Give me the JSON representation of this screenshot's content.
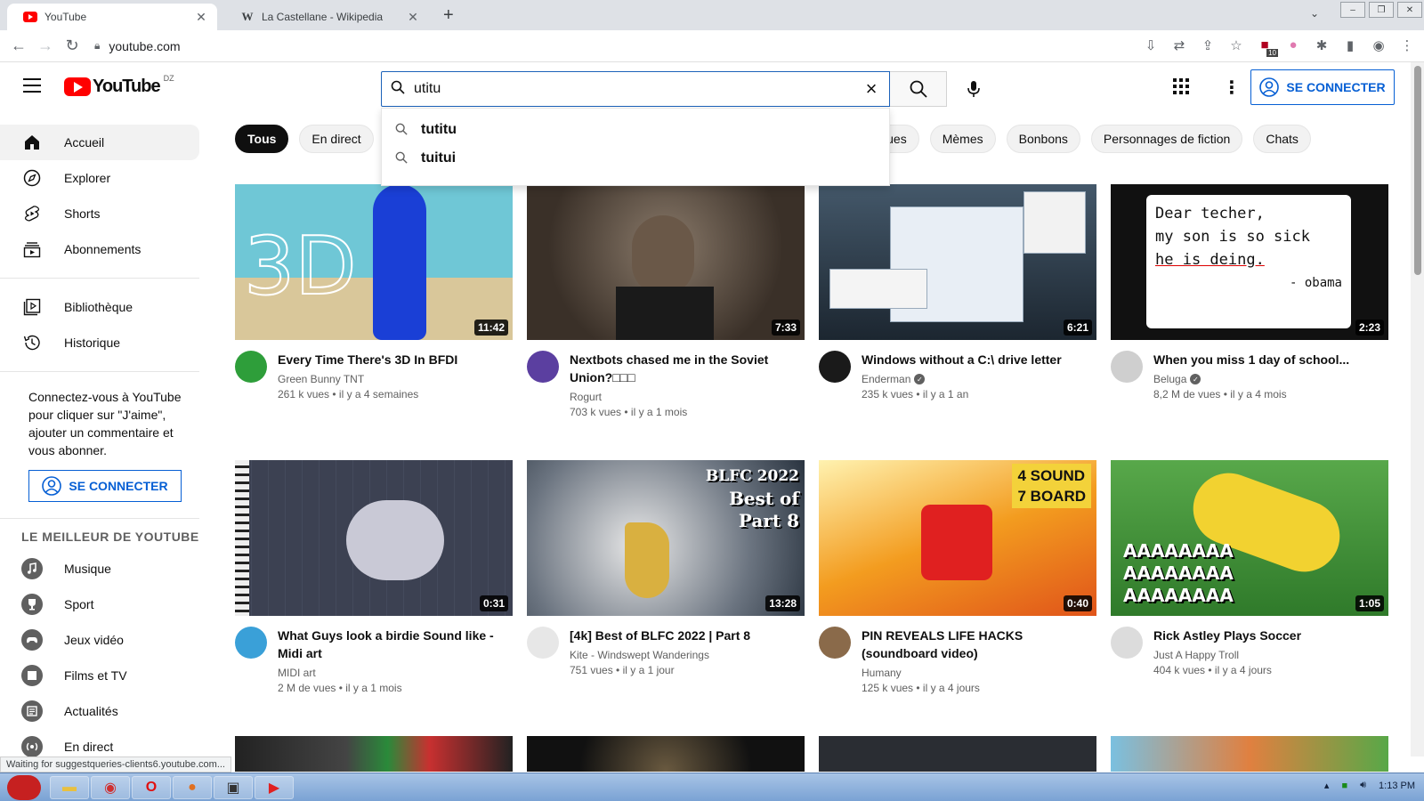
{
  "browser": {
    "tabs": [
      {
        "title": "YouTube",
        "active": true
      },
      {
        "title": "La Castellane - Wikipedia",
        "active": false
      }
    ],
    "url": "youtube.com",
    "status_text": "Waiting for suggestqueries-clients6.youtube.com...",
    "ext_badge": "10"
  },
  "header": {
    "logo_text": "YouTube",
    "region": "DZ",
    "search_value": "utitu",
    "signin_label": "SE CONNECTER"
  },
  "suggestions": [
    "tutitu",
    "tuitui"
  ],
  "sidebar": {
    "main": [
      {
        "label": "Accueil",
        "icon": "home-icon",
        "active": true
      },
      {
        "label": "Explorer",
        "icon": "compass-icon"
      },
      {
        "label": "Shorts",
        "icon": "shorts-icon"
      },
      {
        "label": "Abonnements",
        "icon": "subscriptions-icon"
      }
    ],
    "library": [
      {
        "label": "Bibliothèque",
        "icon": "library-icon"
      },
      {
        "label": "Historique",
        "icon": "history-icon"
      }
    ],
    "promo_text": "Connectez-vous à YouTube pour cliquer sur \"J'aime\", ajouter un commentaire et vous abonner.",
    "signin_label": "SE CONNECTER",
    "best_title": "LE MEILLEUR DE YOUTUBE",
    "best": [
      {
        "label": "Musique",
        "icon": "music-icon"
      },
      {
        "label": "Sport",
        "icon": "trophy-icon"
      },
      {
        "label": "Jeux vidéo",
        "icon": "gaming-icon"
      },
      {
        "label": "Films et TV",
        "icon": "film-icon"
      },
      {
        "label": "Actualités",
        "icon": "news-icon"
      },
      {
        "label": "En direct",
        "icon": "live-icon"
      }
    ]
  },
  "chips": [
    "Tous",
    "En direct",
    "atériels informatiques",
    "Mèmes",
    "Bonbons",
    "Personnages de fiction",
    "Chats"
  ],
  "videos": [
    {
      "title": "Every Time There's 3D In BFDI",
      "channel": "Green Bunny TNT",
      "verified": false,
      "stats": "261 k vues • il y a 4 semaines",
      "duration": "11:42",
      "thumb_color": "#6fc7d6",
      "avatar_color": "#2e9e3a"
    },
    {
      "title": "Nextbots chased me in the Soviet Union?□□□",
      "channel": "Rogurt",
      "verified": false,
      "stats": "703 k vues • il y a 1 mois",
      "duration": "7:33",
      "thumb_color": "#6b5a4a",
      "avatar_color": "#5b3fa0"
    },
    {
      "title": "Windows without a C:\\ drive letter",
      "channel": "Enderman",
      "verified": true,
      "stats": "235 k vues • il y a 1 an",
      "duration": "6:21",
      "thumb_color": "#2b3a4a",
      "avatar_color": "#1a1a1a"
    },
    {
      "title": "When you miss 1 day of school...",
      "channel": "Beluga",
      "verified": true,
      "stats": "8,2 M de vues • il y a 4 mois",
      "duration": "2:23",
      "thumb_color": "#111111",
      "avatar_color": "#cfcfcf"
    },
    {
      "title": "What Guys look a birdie Sound like - Midi art",
      "channel": "MIDI art",
      "verified": false,
      "stats": "2 M de vues • il y a 1 mois",
      "duration": "0:31",
      "thumb_color": "#3c4152",
      "avatar_color": "#3aa0d8"
    },
    {
      "title": "[4k] Best of BLFC 2022 | Part 8",
      "channel": "Kite - Windswept Wanderings",
      "verified": false,
      "stats": "751 vues • il y a 1 jour",
      "duration": "13:28",
      "thumb_color": "#3b4a5c",
      "avatar_color": "#e7e7e7"
    },
    {
      "title": "PIN REVEALS LIFE HACKS (soundboard video)",
      "channel": "Humany",
      "verified": false,
      "stats": "125 k vues • il y a 4 jours",
      "duration": "0:40",
      "thumb_color": "#f0a020",
      "avatar_color": "#8a6a4a"
    },
    {
      "title": "Rick Astley Plays Soccer",
      "channel": "Just A Happy Troll",
      "verified": false,
      "stats": "404 k vues • il y a 4 jours",
      "duration": "1:05",
      "thumb_color": "#3f8a34",
      "avatar_color": "#dcdcdc"
    }
  ],
  "thumb_texts": {
    "v1": "3D",
    "v4": [
      "Dear techer,",
      "my son is so sick",
      "he is deing.",
      "- obama"
    ],
    "v6": [
      "BLFC 2022",
      "Best of",
      "Part 8"
    ],
    "v7": [
      "4 SOUND",
      "7 BOARD"
    ],
    "v8": [
      "AAAAAAAA",
      "AAAAAAAA",
      "AAAAAAAA"
    ]
  },
  "taskbar": {
    "time": "1:13 PM"
  },
  "colors": {
    "brand_red": "#ff0000",
    "link_blue": "#065fd4",
    "chip_bg": "#f2f2f2"
  }
}
